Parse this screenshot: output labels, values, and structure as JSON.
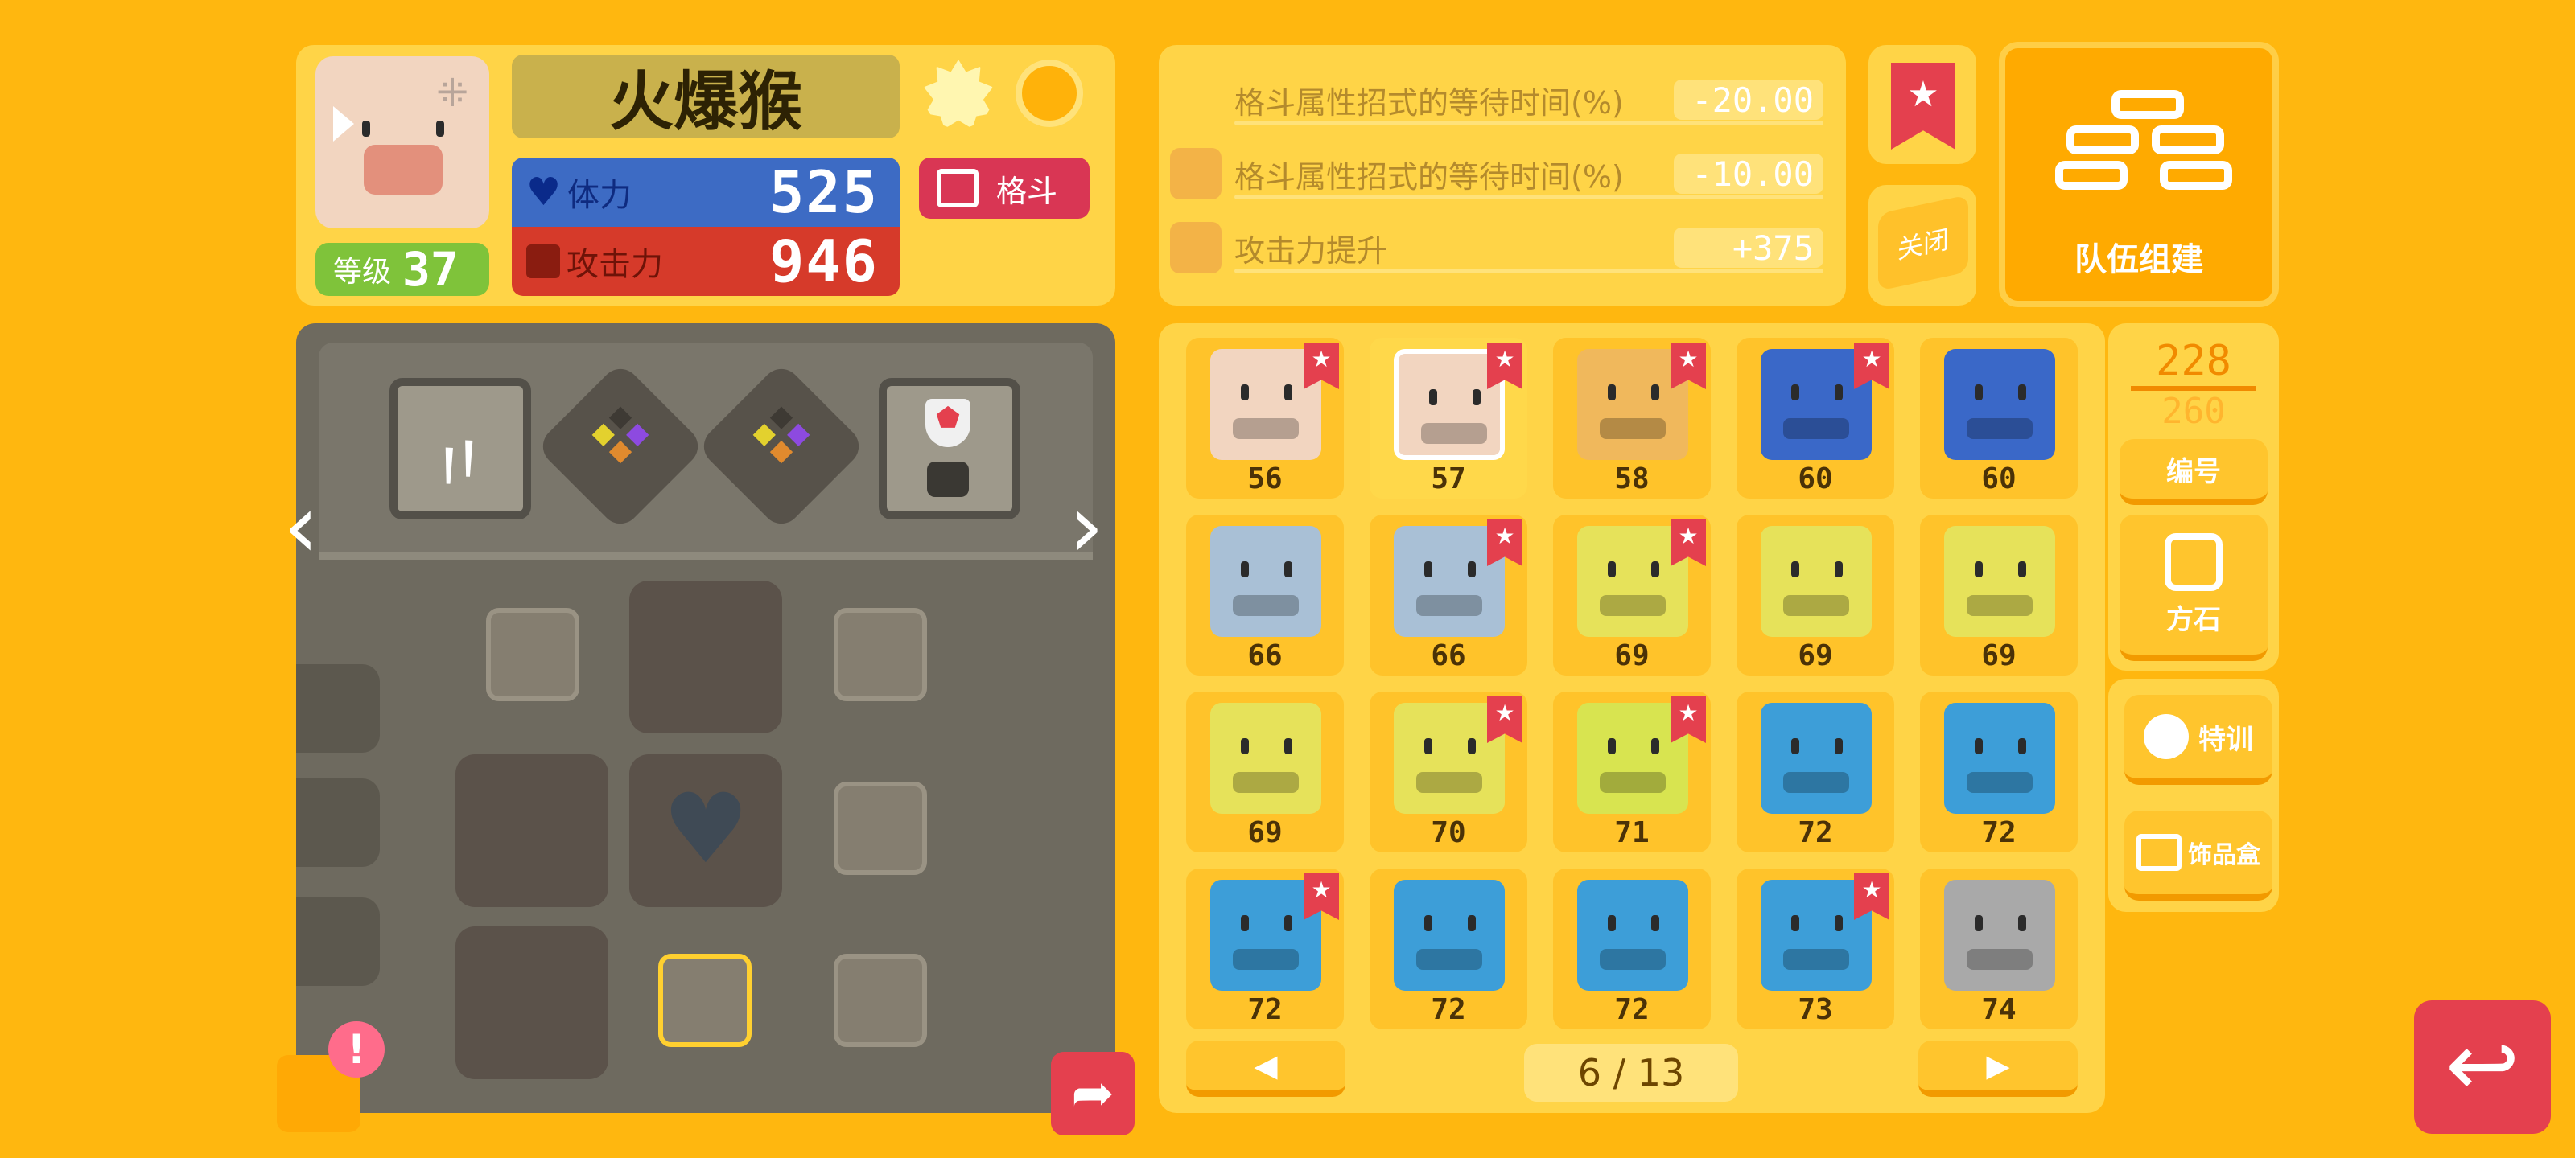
{
  "pokemon": {
    "name": "火爆猴",
    "level_label": "等级",
    "level": "37",
    "hp_label": "体力",
    "hp": "525",
    "atk_label": "攻击力",
    "atk": "946",
    "type_label": "格斗"
  },
  "bonuses": [
    {
      "text": "格斗属性招式的等待时间(%)",
      "value": "-20.00"
    },
    {
      "text": "格斗属性招式的等待时间(%)",
      "value": "-10.00"
    },
    {
      "text": "攻击力提升",
      "value": "+375"
    }
  ],
  "buttons": {
    "close": "关闭",
    "team_build": "队伍组建",
    "number": "编号",
    "stone": "方石",
    "training": "特训",
    "accessory_box": "饰品盒"
  },
  "box_count": {
    "current": "228",
    "max": "260"
  },
  "page": "6 / 13",
  "nav": {
    "prev": "◀",
    "next": "▶"
  },
  "grid": [
    {
      "num": "56",
      "color": "#f2d5c0",
      "starred": true
    },
    {
      "num": "57",
      "color": "#f2d5c0",
      "starred": true
    },
    {
      "num": "58",
      "color": "#f0b85c",
      "starred": true
    },
    {
      "num": "60",
      "color": "#3a68c8",
      "starred": true
    },
    {
      "num": "60",
      "color": "#3a68c8",
      "starred": false
    },
    {
      "num": "66",
      "color": "#a9c0d6",
      "starred": false
    },
    {
      "num": "66",
      "color": "#a9c0d6",
      "starred": true
    },
    {
      "num": "69",
      "color": "#e6e25a",
      "starred": true
    },
    {
      "num": "69",
      "color": "#e6e25a",
      "starred": false
    },
    {
      "num": "69",
      "color": "#e6e25a",
      "starred": false
    },
    {
      "num": "69",
      "color": "#e6e25a",
      "starred": false
    },
    {
      "num": "70",
      "color": "#e6e25a",
      "starred": true
    },
    {
      "num": "71",
      "color": "#d8e450",
      "starred": true
    },
    {
      "num": "72",
      "color": "#3d9ed8",
      "starred": false
    },
    {
      "num": "72",
      "color": "#3d9ed8",
      "starred": false
    },
    {
      "num": "72",
      "color": "#3d9ed8",
      "starred": true
    },
    {
      "num": "72",
      "color": "#3d9ed8",
      "starred": false
    },
    {
      "num": "72",
      "color": "#3d9ed8",
      "starred": false
    },
    {
      "num": "73",
      "color": "#3d9ed8",
      "starred": true
    },
    {
      "num": "74",
      "color": "#a9a9a9",
      "starred": false
    }
  ],
  "colors": {
    "background": "#ffb70f",
    "hp_bar": "#3d6bc4",
    "atk_bar": "#d63a2a",
    "fighting": "#d93654",
    "star_tag": "#e4404e"
  }
}
